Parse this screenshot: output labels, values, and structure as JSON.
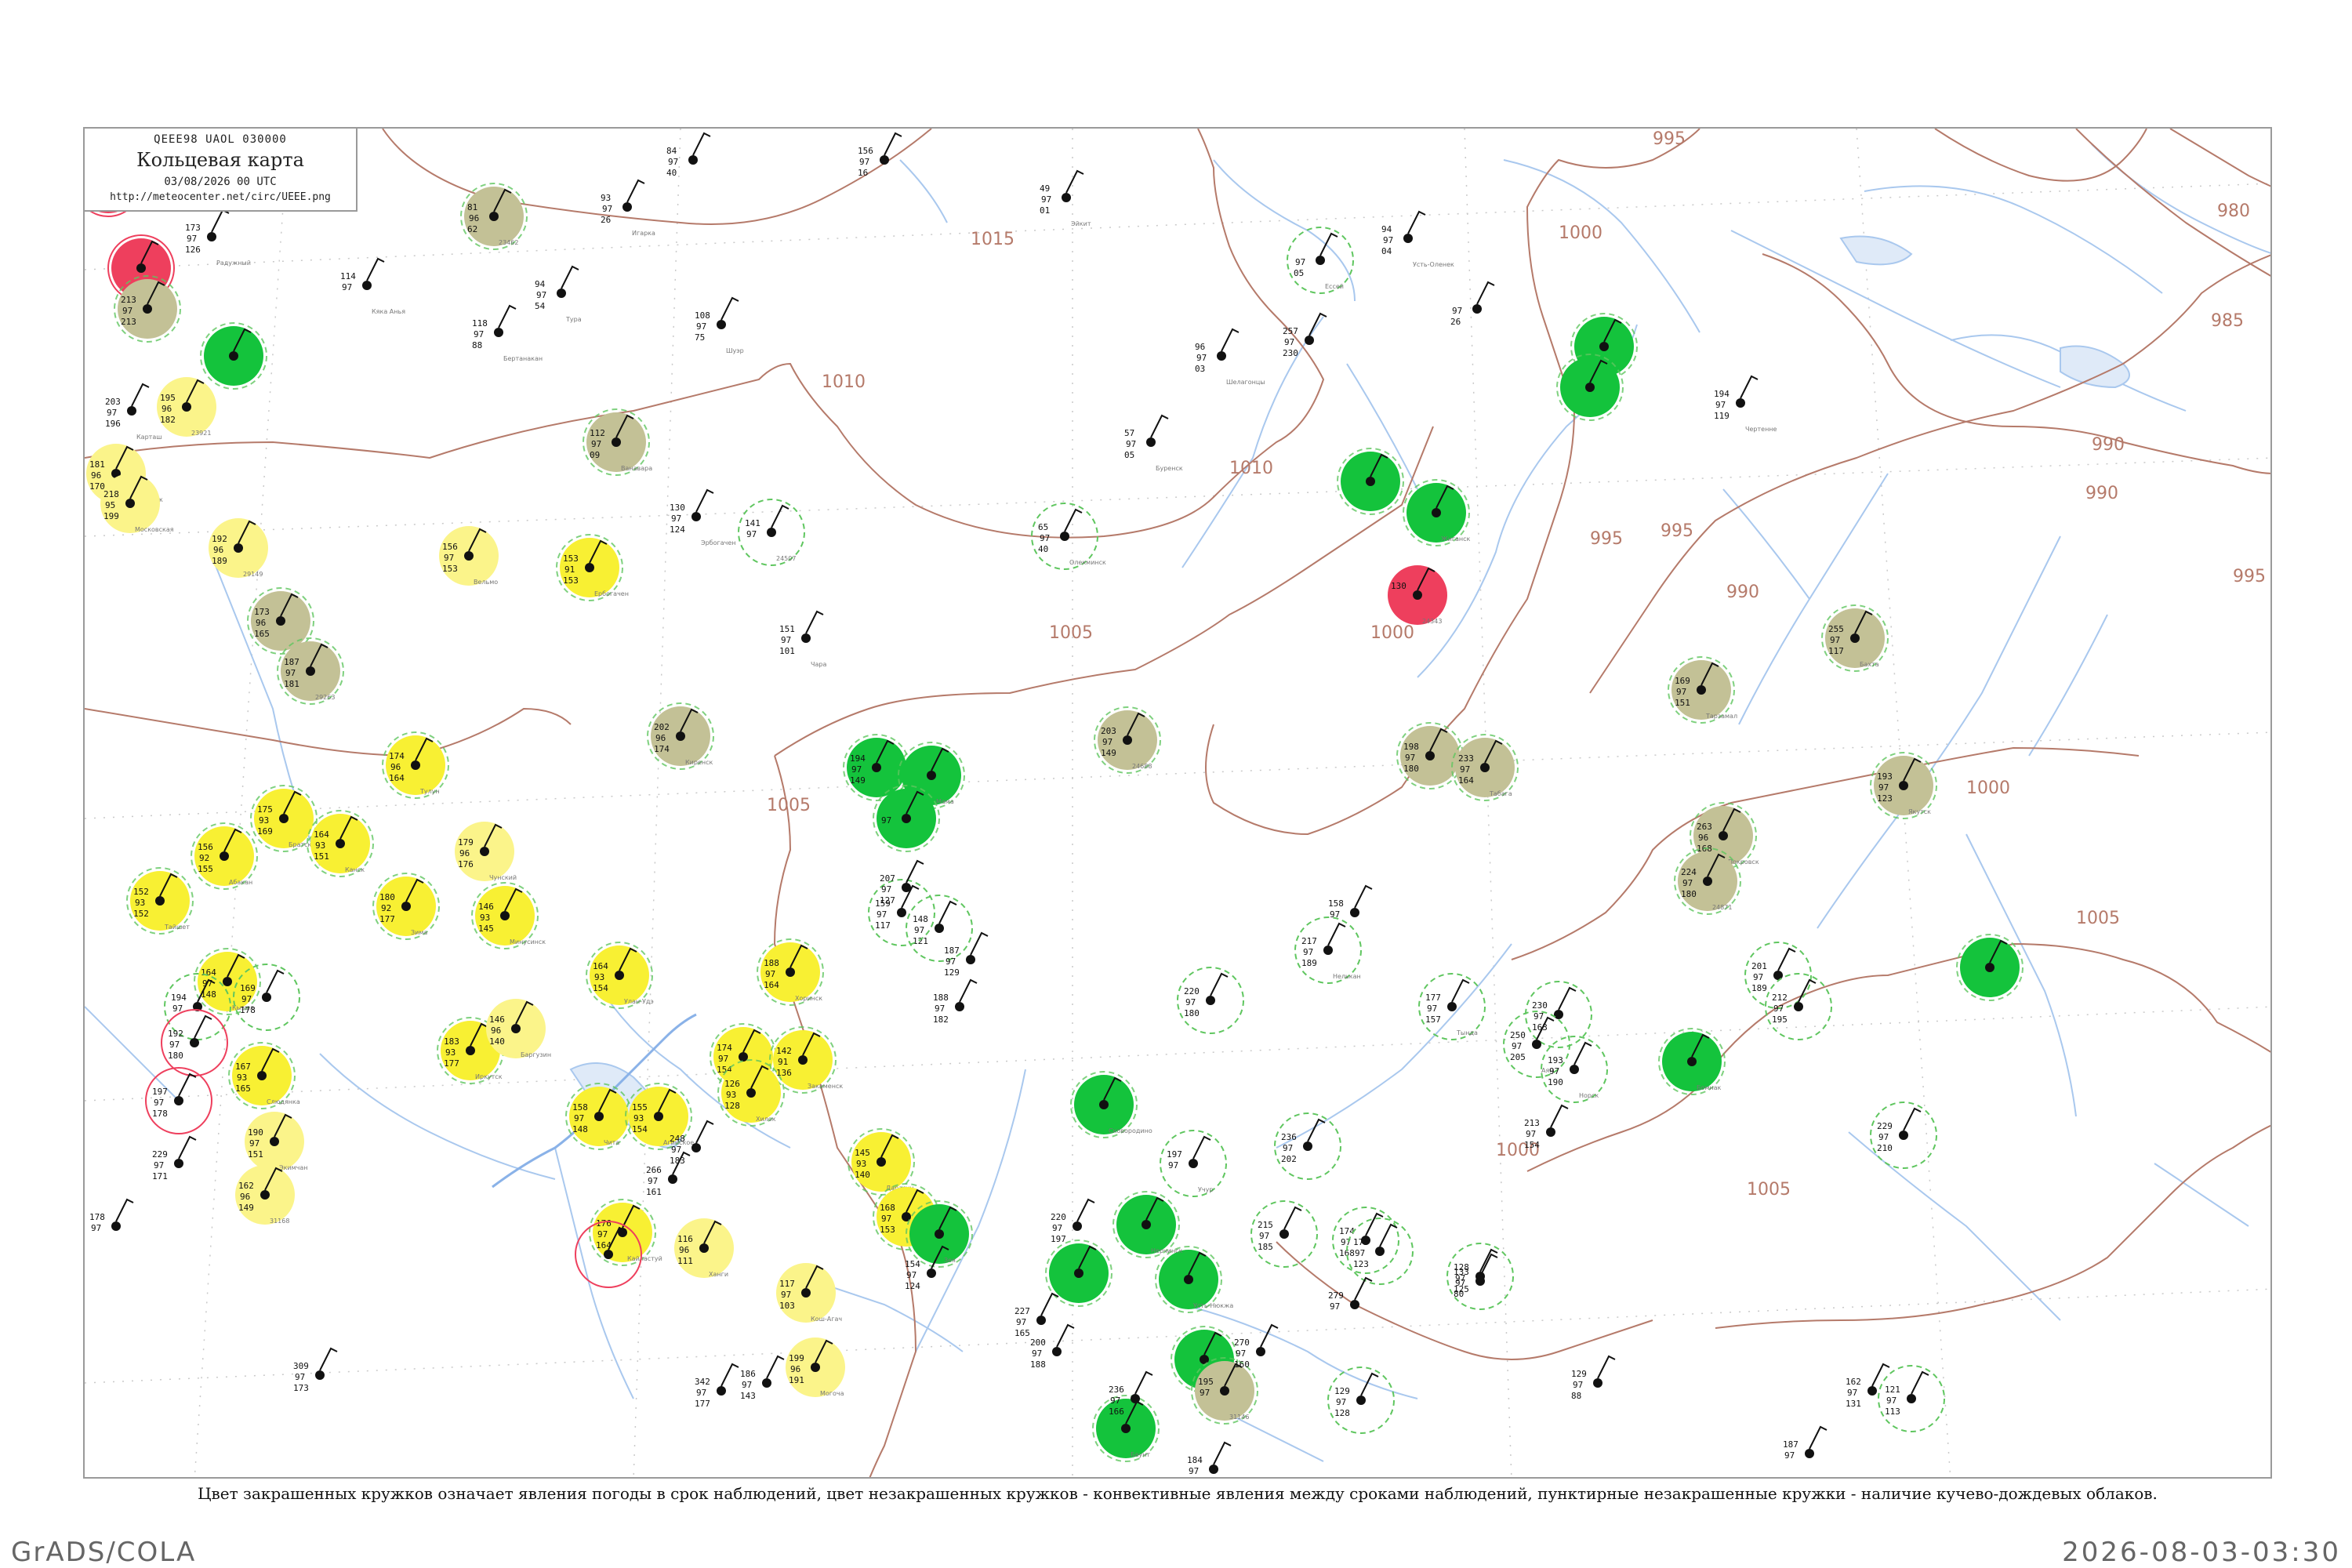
{
  "legend": {
    "code": "QEEE98 UAOL 030000",
    "title": "Кольцевая карта",
    "date": "03/08/2026 00 UTC",
    "url": "http://meteocenter.net/circ/UEEE.png"
  },
  "caption": "Цвет закрашенных кружков означает явления погоды в срок наблюдений, цвет незакрашенных кружков - конвективные явления между сроками наблюдений, пунктирные незакрашенные кружки - наличие кучево-дождевых облаков.",
  "footer": {
    "left": "GrADS/COLA",
    "right": "2026-08-03-03:30"
  },
  "colors": {
    "isobar": "#b57a6a",
    "river": "#a9c8ee",
    "shower_green": "#14c33c",
    "thunder_red": "#ee3f5d",
    "rain_yellow": "#f8f033",
    "light_yellow": "#fbf48a",
    "fog_olive": "#c3c196",
    "cb_dash": "#5fc65f",
    "frame": "#9a9a9a"
  },
  "isobar_labels": [
    "1015",
    "1010",
    "1010",
    "1005",
    "1005",
    "1000",
    "1000",
    "1000",
    "995",
    "995",
    "995",
    "990",
    "990",
    "990",
    "985",
    "980",
    "1005",
    "1005",
    "1000",
    "995"
  ],
  "stations": [
    {
      "kind": "thunder",
      "top": "",
      "a": "",
      "b": "",
      "name": ""
    },
    {
      "kind": "thunder",
      "top": "",
      "a": "",
      "b": "",
      "name": ""
    },
    {
      "kind": "fog",
      "top": "213",
      "a": "97",
      "b": "213",
      "name": ""
    },
    {
      "kind": "shower",
      "top": "",
      "a": "",
      "b": "",
      "name": ""
    },
    {
      "kind": "fog",
      "top": "81",
      "a": "96",
      "b": "62",
      "name": "23462"
    },
    {
      "kind": "none",
      "top": "173",
      "a": "97",
      "b": "126",
      "name": "Радужный"
    },
    {
      "kind": "none",
      "top": "93",
      "a": "97",
      "b": "26",
      "name": "Игарка"
    },
    {
      "kind": "none",
      "top": "84",
      "a": "97",
      "b": "40",
      "name": ""
    },
    {
      "kind": "none",
      "top": "156",
      "a": "97",
      "b": "16",
      "name": ""
    },
    {
      "kind": "none",
      "top": "49",
      "a": "97",
      "b": "01",
      "name": "Эйкит"
    },
    {
      "kind": "cbdash",
      "top": "",
      "a": "97",
      "b": "05",
      "name": "Ессей"
    },
    {
      "kind": "none",
      "top": "94",
      "a": "97",
      "b": "04",
      "name": "Усть-Оленек"
    },
    {
      "kind": "none",
      "top": "",
      "a": "97",
      "b": "26",
      "name": ""
    },
    {
      "kind": "shower",
      "top": "",
      "a": "",
      "b": "",
      "name": ""
    },
    {
      "kind": "shower",
      "top": "",
      "a": "",
      "b": "",
      "name": ""
    },
    {
      "kind": "lightyellow",
      "top": "195",
      "a": "96",
      "b": "182",
      "name": "23921"
    },
    {
      "kind": "none",
      "top": "203",
      "a": "97",
      "b": "196",
      "name": "Карташ"
    },
    {
      "kind": "none",
      "top": "114",
      "a": "97",
      "b": "",
      "name": "Кяка Анья"
    },
    {
      "kind": "none",
      "top": "94",
      "a": "97",
      "b": "54",
      "name": "Тура"
    },
    {
      "kind": "none",
      "top": "108",
      "a": "97",
      "b": "75",
      "name": "Шуэр"
    },
    {
      "kind": "none",
      "top": "118",
      "a": "97",
      "b": "88",
      "name": "Бертанакан"
    },
    {
      "kind": "none",
      "top": "257",
      "a": "97",
      "b": "230",
      "name": ""
    },
    {
      "kind": "none",
      "top": "96",
      "a": "97",
      "b": "03",
      "name": "Шелагонцы"
    },
    {
      "kind": "none",
      "top": "194",
      "a": "97",
      "b": "119",
      "name": "Чертенне"
    },
    {
      "kind": "fog",
      "top": "112",
      "a": "97",
      "b": "09",
      "name": "Ванавара"
    },
    {
      "kind": "lightyellow",
      "top": "181",
      "a": "96",
      "b": "170",
      "name": "Анзиябольск"
    },
    {
      "kind": "lightyellow",
      "top": "218",
      "a": "95",
      "b": "199",
      "name": "Московская"
    },
    {
      "kind": "shower",
      "top": "",
      "a": "",
      "b": "",
      "name": ""
    },
    {
      "kind": "shower",
      "top": "",
      "a": "",
      "b": "",
      "name": "Жиганск"
    },
    {
      "kind": "thunder",
      "top": "130",
      "a": "",
      "b": "",
      "name": "24343"
    },
    {
      "kind": "none",
      "top": "130",
      "a": "97",
      "b": "124",
      "name": "Эрбогачен"
    },
    {
      "kind": "cbdash",
      "top": "141",
      "a": "97",
      "b": "",
      "name": "24507"
    },
    {
      "kind": "cbdash",
      "top": "65",
      "a": "97",
      "b": "40",
      "name": "Олекминск"
    },
    {
      "kind": "none",
      "top": "57",
      "a": "97",
      "b": "05",
      "name": "Буренск"
    },
    {
      "kind": "lightyellow",
      "top": "192",
      "a": "96",
      "b": "189",
      "name": "29149"
    },
    {
      "kind": "lightyellow",
      "top": "156",
      "a": "97",
      "b": "153",
      "name": "Вельмо"
    },
    {
      "kind": "rain",
      "top": "153",
      "a": "91",
      "b": "153",
      "name": "Ербогачен"
    },
    {
      "kind": "fog",
      "top": "173",
      "a": "96",
      "b": "165",
      "name": ""
    },
    {
      "kind": "fog",
      "top": "187",
      "a": "97",
      "b": "181",
      "name": "29263"
    },
    {
      "kind": "fog",
      "top": "255",
      "a": "97",
      "b": "117",
      "name": "Бахта"
    },
    {
      "kind": "none",
      "top": "151",
      "a": "97",
      "b": "101",
      "name": "Чара"
    },
    {
      "kind": "fog",
      "top": "202",
      "a": "96",
      "b": "174",
      "name": "Киренск"
    },
    {
      "kind": "shower",
      "top": "194",
      "a": "97",
      "b": "149",
      "name": ""
    },
    {
      "kind": "shower",
      "top": "",
      "a": "",
      "b": "",
      "name": "Мама"
    },
    {
      "kind": "shower",
      "top": "",
      "a": "97",
      "b": "",
      "name": ""
    },
    {
      "kind": "fog",
      "top": "203",
      "a": "97",
      "b": "149",
      "name": "24688"
    },
    {
      "kind": "fog",
      "top": "169",
      "a": "97",
      "b": "151",
      "name": "Тарзамал"
    },
    {
      "kind": "fog",
      "top": "198",
      "a": "97",
      "b": "180",
      "name": ""
    },
    {
      "kind": "fog",
      "top": "233",
      "a": "97",
      "b": "164",
      "name": "Табага"
    },
    {
      "kind": "fog",
      "top": "193",
      "a": "97",
      "b": "123",
      "name": "Якутск"
    },
    {
      "kind": "fog",
      "top": "263",
      "a": "96",
      "b": "168",
      "name": "Покровск"
    },
    {
      "kind": "fog",
      "top": "224",
      "a": "97",
      "b": "180",
      "name": "24871"
    },
    {
      "kind": "rain",
      "top": "174",
      "a": "96",
      "b": "164",
      "name": "Тулун"
    },
    {
      "kind": "rain",
      "top": "175",
      "a": "93",
      "b": "169",
      "name": "Братск"
    },
    {
      "kind": "rain",
      "top": "164",
      "a": "93",
      "b": "151",
      "name": "Канск"
    },
    {
      "kind": "lightyellow",
      "top": "179",
      "a": "96",
      "b": "176",
      "name": "Чунский"
    },
    {
      "kind": "rain",
      "top": "156",
      "a": "92",
      "b": "155",
      "name": "Абакан"
    },
    {
      "kind": "rain",
      "top": "152",
      "a": "93",
      "b": "152",
      "name": "Тайшет"
    },
    {
      "kind": "rain",
      "top": "180",
      "a": "92",
      "b": "177",
      "name": "Зима"
    },
    {
      "kind": "rain",
      "top": "146",
      "a": "93",
      "b": "145",
      "name": "Минусинск"
    },
    {
      "kind": "rain",
      "top": "164",
      "a": "97",
      "b": "148",
      "name": "Кызыл"
    },
    {
      "kind": "rain",
      "top": "167",
      "a": "93",
      "b": "165",
      "name": "Слюдянка"
    },
    {
      "kind": "rain",
      "top": "183",
      "a": "93",
      "b": "177",
      "name": "Иркутск"
    },
    {
      "kind": "lightyellow",
      "top": "146",
      "a": "96",
      "b": "140",
      "name": "Баргузин"
    },
    {
      "kind": "rain",
      "top": "164",
      "a": "93",
      "b": "154",
      "name": "Улан-Удэ"
    },
    {
      "kind": "rain",
      "top": "188",
      "a": "97",
      "b": "164",
      "name": "Хоринск"
    },
    {
      "kind": "rain",
      "top": "174",
      "a": "97",
      "b": "154",
      "name": "Кяхта"
    },
    {
      "kind": "rain",
      "top": "142",
      "a": "91",
      "b": "136",
      "name": "Закаменск"
    },
    {
      "kind": "rain",
      "top": "126",
      "a": "93",
      "b": "128",
      "name": "Хилок"
    },
    {
      "kind": "rain",
      "top": "158",
      "a": "97",
      "b": "148",
      "name": "Чита"
    },
    {
      "kind": "rain",
      "top": "155",
      "a": "93",
      "b": "154",
      "name": "Агинское"
    },
    {
      "kind": "rain",
      "top": "145",
      "a": "93",
      "b": "140",
      "name": "Дарасун"
    },
    {
      "kind": "rain",
      "top": "168",
      "a": "97",
      "b": "153",
      "name": "Борзя"
    },
    {
      "kind": "rain",
      "top": "176",
      "a": "97",
      "b": "164",
      "name": "Кайластуй"
    },
    {
      "kind": "lightyellow",
      "top": "116",
      "a": "96",
      "b": "111",
      "name": "Ханги"
    },
    {
      "kind": "lightyellow",
      "top": "117",
      "a": "97",
      "b": "103",
      "name": "Кош-Агач"
    },
    {
      "kind": "lightyellow",
      "top": "199",
      "a": "96",
      "b": "191",
      "name": "Могоча"
    },
    {
      "kind": "lightyellow",
      "top": "190",
      "a": "97",
      "b": "151",
      "name": "Экимчан"
    },
    {
      "kind": "lightyellow",
      "top": "162",
      "a": "96",
      "b": "149",
      "name": "31168"
    },
    {
      "kind": "shower",
      "top": "",
      "a": "",
      "b": "",
      "name": "Усть-Нюкжа"
    },
    {
      "kind": "shower",
      "top": "",
      "a": "",
      "b": "",
      "name": "Сковородино"
    },
    {
      "kind": "shower",
      "top": "",
      "a": "",
      "b": "",
      "name": "Бомнак"
    },
    {
      "kind": "shower",
      "top": "",
      "a": "",
      "b": "",
      "name": ""
    },
    {
      "kind": "shower",
      "top": "",
      "a": "",
      "b": "",
      "name": ""
    },
    {
      "kind": "shower",
      "top": "",
      "a": "",
      "b": "",
      "name": "Нерчинск"
    },
    {
      "kind": "shower",
      "top": "",
      "a": "",
      "b": "",
      "name": "Зея"
    },
    {
      "kind": "shower",
      "top": "",
      "a": "",
      "b": "",
      "name": "Дзуев"
    },
    {
      "kind": "shower",
      "top": "",
      "a": "",
      "b": "",
      "name": "Баунт"
    },
    {
      "kind": "fog",
      "top": "195",
      "a": "97",
      "b": "",
      "name": "31146"
    },
    {
      "kind": "cbdash",
      "top": "197",
      "a": "97",
      "b": "",
      "name": "Учур"
    },
    {
      "kind": "cbdash",
      "top": "217",
      "a": "97",
      "b": "189",
      "name": "Нелькан"
    },
    {
      "kind": "cbdash",
      "top": "230",
      "a": "97",
      "b": "163",
      "name": ""
    },
    {
      "kind": "cbdash",
      "top": "250",
      "a": "97",
      "b": "205",
      "name": "Аян"
    },
    {
      "kind": "cbdash",
      "top": "177",
      "a": "97",
      "b": "157",
      "name": "Тында"
    },
    {
      "kind": "cbdash",
      "top": "193",
      "a": "97",
      "b": "190",
      "name": "Норск"
    },
    {
      "kind": "cbdash",
      "top": "201",
      "a": "97",
      "b": "189",
      "name": ""
    },
    {
      "kind": "cbdash",
      "top": "212",
      "a": "97",
      "b": "195",
      "name": ""
    },
    {
      "kind": "cbdash",
      "top": "229",
      "a": "97",
      "b": "210",
      "name": ""
    },
    {
      "kind": "cbdash",
      "top": "220",
      "a": "97",
      "b": "180",
      "name": ""
    },
    {
      "kind": "cbdash",
      "top": "236",
      "a": "97",
      "b": "202",
      "name": ""
    },
    {
      "kind": "cbdash",
      "top": "215",
      "a": "97",
      "b": "185",
      "name": ""
    },
    {
      "kind": "cbdash",
      "top": "174",
      "a": "97",
      "b": "168",
      "name": ""
    },
    {
      "kind": "cbdash",
      "top": "175",
      "a": "97",
      "b": "123",
      "name": ""
    },
    {
      "kind": "cbdash",
      "top": "128",
      "a": "97",
      "b": "125",
      "name": ""
    },
    {
      "kind": "cbdash",
      "top": "129",
      "a": "97",
      "b": "128",
      "name": ""
    },
    {
      "kind": "cbdash",
      "top": "121",
      "a": "97",
      "b": "113",
      "name": ""
    },
    {
      "kind": "cbdash",
      "top": "148",
      "a": "97",
      "b": "121",
      "name": ""
    },
    {
      "kind": "cbdash",
      "top": "159",
      "a": "97",
      "b": "117",
      "name": ""
    },
    {
      "kind": "cbdash",
      "top": "169",
      "a": "97",
      "b": "178",
      "name": ""
    },
    {
      "kind": "cbdash",
      "top": "194",
      "a": "97",
      "b": "",
      "name": ""
    },
    {
      "kind": "cbthunder",
      "top": "192",
      "a": "97",
      "b": "180",
      "name": ""
    },
    {
      "kind": "cbthunder",
      "top": "197",
      "a": "97",
      "b": "178",
      "name": ""
    },
    {
      "kind": "cbthunder",
      "top": "",
      "a": "",
      "b": "",
      "name": ""
    },
    {
      "kind": "none",
      "top": "186",
      "a": "97",
      "b": "143",
      "name": ""
    },
    {
      "kind": "none",
      "top": "188",
      "a": "97",
      "b": "182",
      "name": ""
    },
    {
      "kind": "none",
      "top": "200",
      "a": "97",
      "b": "188",
      "name": ""
    },
    {
      "kind": "none",
      "top": "187",
      "a": "97",
      "b": "129",
      "name": ""
    },
    {
      "kind": "none",
      "top": "227",
      "a": "97",
      "b": "165",
      "name": ""
    },
    {
      "kind": "none",
      "top": "236",
      "a": "97",
      "b": "166",
      "name": ""
    },
    {
      "kind": "none",
      "top": "270",
      "a": "97",
      "b": "160",
      "name": ""
    },
    {
      "kind": "none",
      "top": "279",
      "a": "97",
      "b": "",
      "name": ""
    },
    {
      "kind": "none",
      "top": "133",
      "a": "97",
      "b": "80",
      "name": ""
    },
    {
      "kind": "none",
      "top": "129",
      "a": "97",
      "b": "88",
      "name": ""
    },
    {
      "kind": "none",
      "top": "187",
      "a": "97",
      "b": "",
      "name": ""
    },
    {
      "kind": "none",
      "top": "184",
      "a": "97",
      "b": "174",
      "name": ""
    },
    {
      "kind": "none",
      "top": "162",
      "a": "97",
      "b": "131",
      "name": ""
    },
    {
      "kind": "none",
      "top": "154",
      "a": "97",
      "b": "124",
      "name": ""
    },
    {
      "kind": "none",
      "top": "178",
      "a": "97",
      "b": "",
      "name": ""
    },
    {
      "kind": "none",
      "top": "229",
      "a": "97",
      "b": "171",
      "name": ""
    },
    {
      "kind": "none",
      "top": "309",
      "a": "97",
      "b": "173",
      "name": ""
    },
    {
      "kind": "none",
      "top": "220",
      "a": "97",
      "b": "197",
      "name": ""
    },
    {
      "kind": "none",
      "top": "342",
      "a": "97",
      "b": "177",
      "name": ""
    },
    {
      "kind": "none",
      "top": "248",
      "a": "97",
      "b": "183",
      "name": ""
    },
    {
      "kind": "none",
      "top": "266",
      "a": "97",
      "b": "161",
      "name": ""
    },
    {
      "kind": "none",
      "top": "213",
      "a": "97",
      "b": "154",
      "name": ""
    },
    {
      "kind": "none",
      "top": "207",
      "a": "97",
      "b": "127",
      "name": ""
    },
    {
      "kind": "none",
      "top": "158",
      "a": "97",
      "b": "",
      "name": ""
    }
  ]
}
